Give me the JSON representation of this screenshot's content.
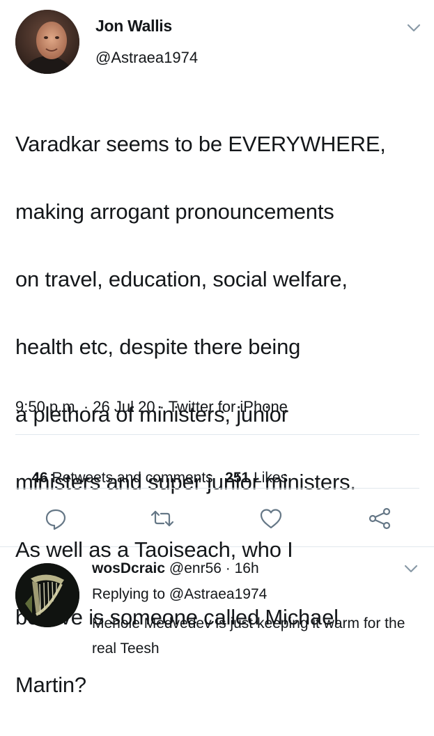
{
  "tweet": {
    "display_name": "Jon Wallis",
    "handle": "@Astraea1974",
    "text_lines": [
      "Varadkar seems to be EVERYWHERE,",
      "making arrogant pronouncements",
      "on travel, education, social welfare,",
      "health etc, despite there being",
      "a plethora of ministers, junior",
      "ministers and super junior ministers.",
      "As well as a Taoiseach, who I",
      "believe is someone called Michael",
      "Martin?"
    ],
    "time": "9:50 p.m.",
    "date": "26 Jul 20",
    "source": "Twitter for iPhone",
    "separator": " · ",
    "retweets_count": "46",
    "retweets_label": "Retweets and comments",
    "likes_count": "251",
    "likes_label": "Likes",
    "icons": [
      "chevron-down-icon",
      "reply-icon",
      "retweet-icon",
      "like-icon",
      "share-icon"
    ]
  },
  "reply": {
    "display_name": "wosDcraic",
    "handle": "@enr56",
    "separator": " · ",
    "age": "16h",
    "replying_prefix": "Replying to ",
    "replying_handle": "@Astraea1974",
    "text": "Mehole Medvedev is just keeping it warm for the real Teesh"
  },
  "colors": {
    "text": "#14171a",
    "icon_gray": "#657786",
    "divider": "#e1e8ed"
  }
}
